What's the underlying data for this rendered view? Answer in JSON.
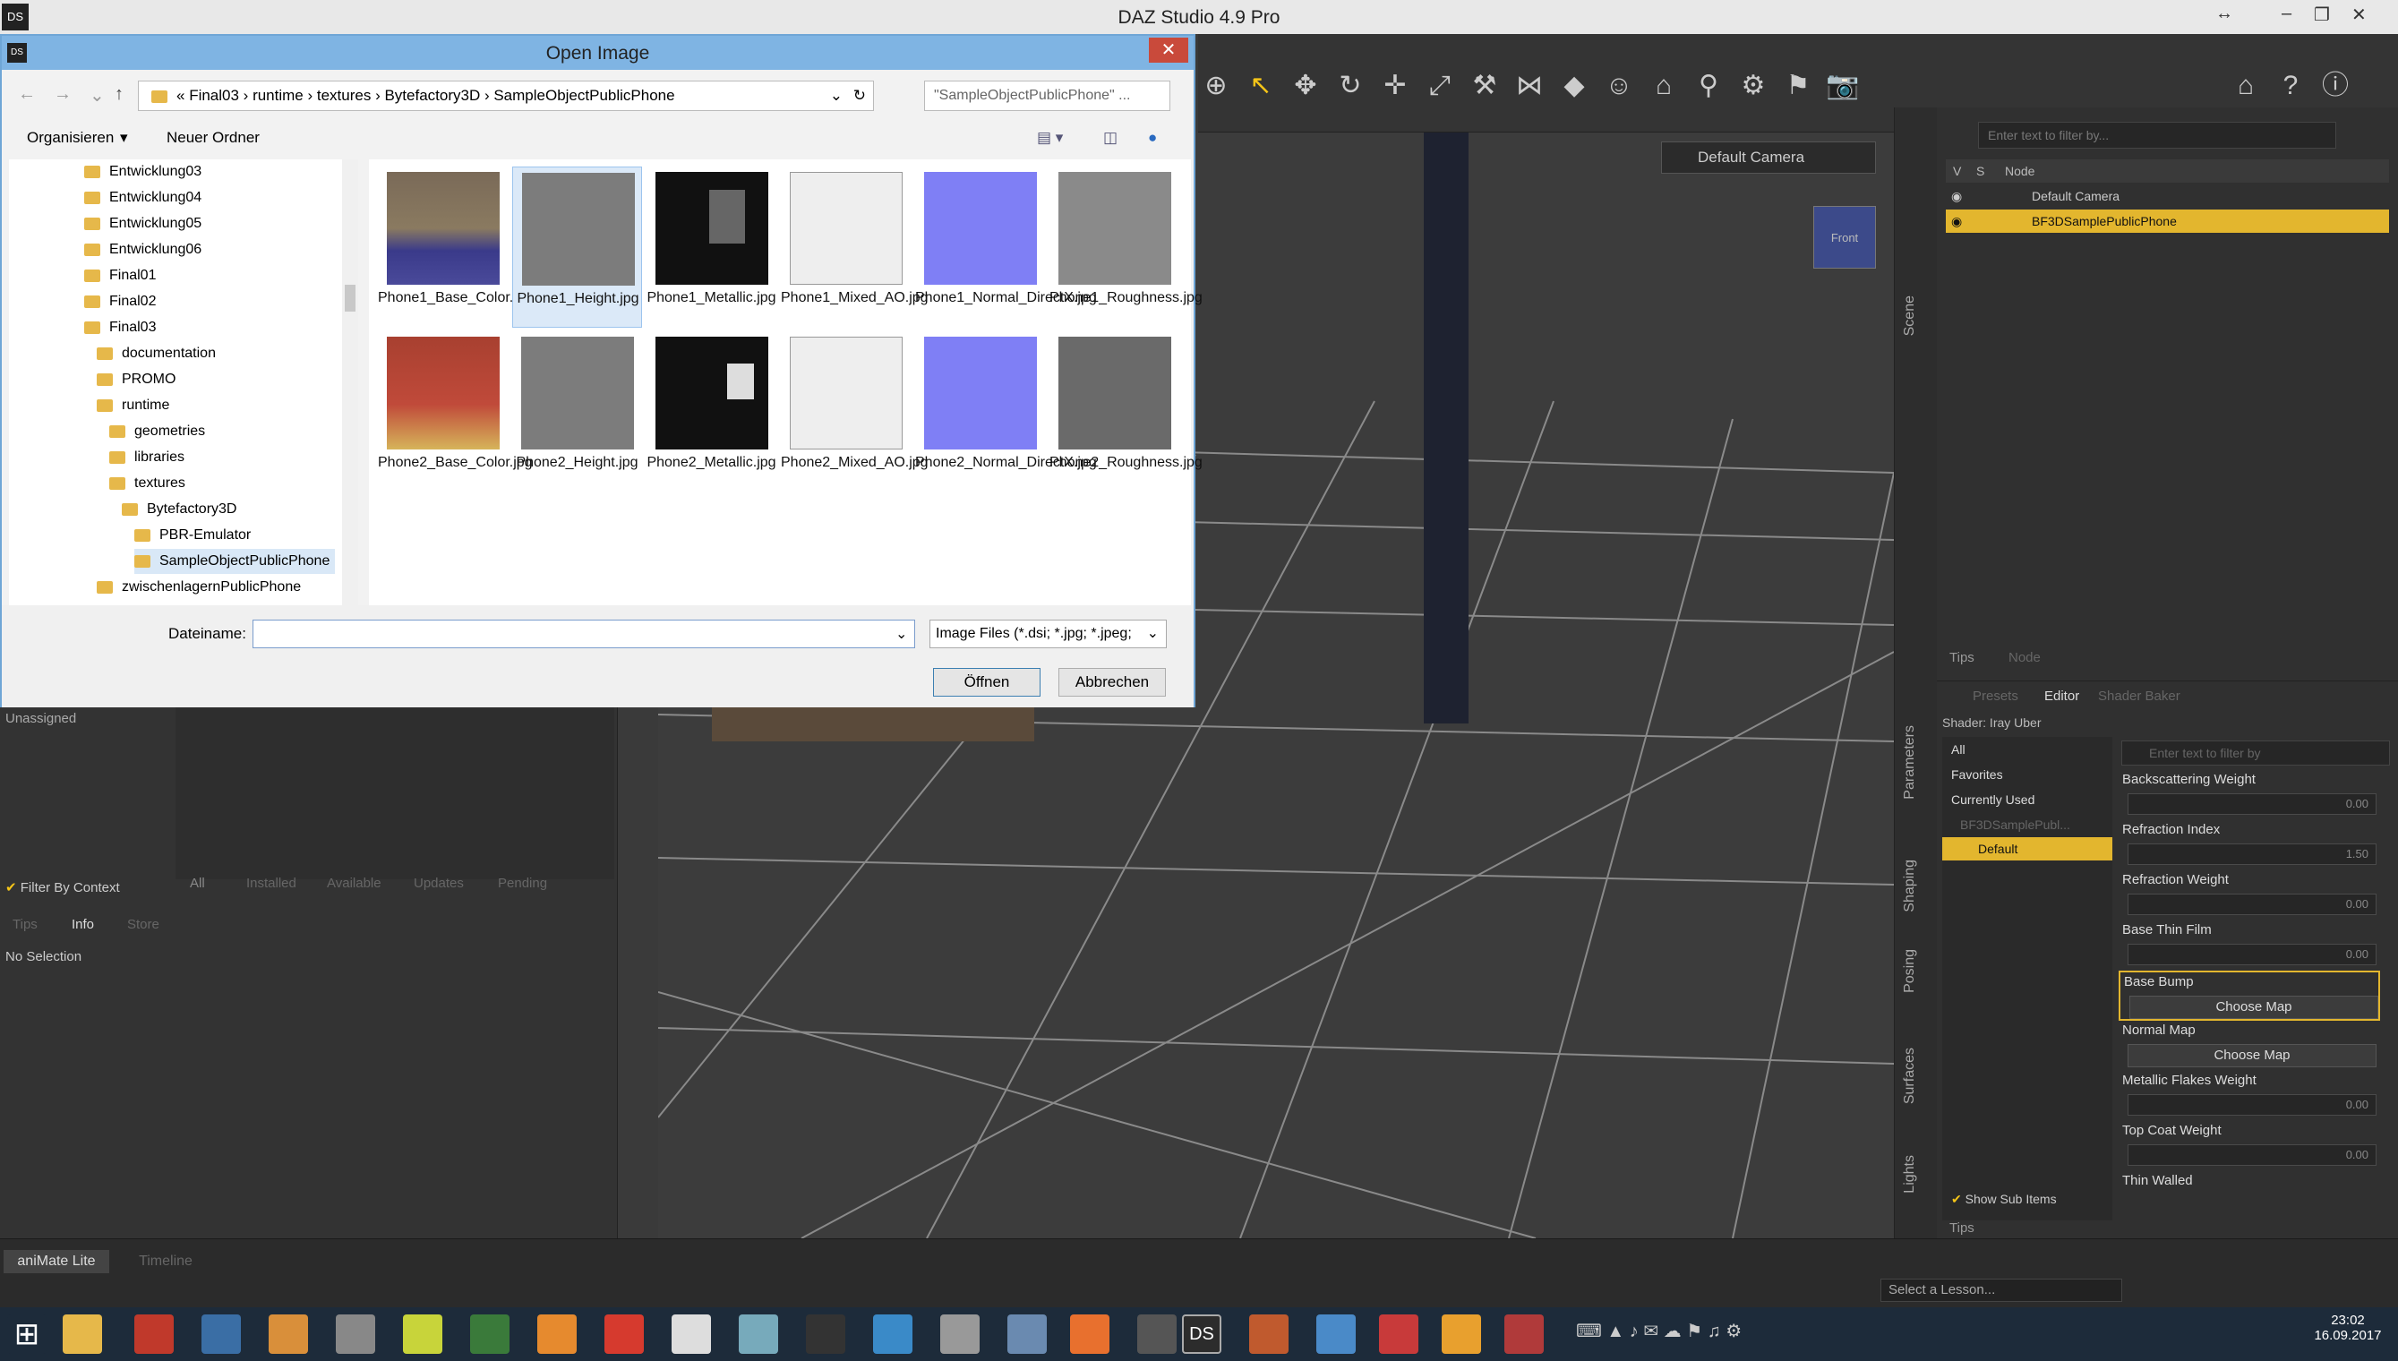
{
  "app": {
    "title": "DAZ Studio 4.9 Pro",
    "logo": "DS"
  },
  "viewport": {
    "camera": "Default Camera",
    "cube_face": "Front"
  },
  "scene": {
    "filter_placeholder": "Enter text to filter by...",
    "col_v": "V",
    "col_s": "S",
    "col_node": "Node",
    "nodes": [
      "Default Camera",
      "BF3DSamplePublicPhone"
    ],
    "tabs": [
      "Tips",
      "Node"
    ]
  },
  "right_tabs": [
    "Scene",
    "Parameters",
    "Shaping",
    "Posing",
    "Surfaces",
    "Lights"
  ],
  "surfaces": {
    "tabs": [
      "Presets",
      "Editor",
      "Shader Baker"
    ],
    "shader": "Shader: Iray Uber",
    "categories": [
      "All",
      "Favorites",
      "Currently Used"
    ],
    "object": "BF3DSamplePubl...",
    "material": "Default",
    "filter_placeholder": "Enter text to filter by",
    "show_sub": "Show Sub Items",
    "props": [
      {
        "label": "Backscattering Weight",
        "value": "0.00"
      },
      {
        "label": "Refraction Index",
        "value": "1.50"
      },
      {
        "label": "Refraction Weight",
        "value": "0.00"
      },
      {
        "label": "Base Thin Film",
        "value": "0.00"
      },
      {
        "label": "Base Bump",
        "button": "Choose Map"
      },
      {
        "label": "Normal Map",
        "button": "Choose Map"
      },
      {
        "label": "Metallic Flakes Weight",
        "value": "0.00"
      },
      {
        "label": "Top Coat Weight",
        "value": "0.00"
      },
      {
        "label": "Thin Walled"
      }
    ],
    "bottom_tab": "Tips"
  },
  "smart_content": {
    "unassigned": "Unassigned",
    "filter_context": "Filter By Context",
    "tabs": [
      "All",
      "Installed",
      "Available",
      "Updates",
      "Pending"
    ],
    "info_tabs": [
      "Tips",
      "Info",
      "Store"
    ],
    "no_selection": "No Selection"
  },
  "bottom": {
    "tabs": [
      "aniMate Lite",
      "Timeline"
    ],
    "lesson": "Select a Lesson..."
  },
  "taskbar": {
    "time": "23:02",
    "date": "16.09.2017"
  },
  "dialog": {
    "title": "Open Image",
    "breadcrumb": [
      "Final03",
      "runtime",
      "textures",
      "Bytefactory3D",
      "SampleObjectPublicPhone"
    ],
    "search_placeholder": "\"SampleObjectPublicPhone\" ...",
    "organize": "Organisieren",
    "new_folder": "Neuer Ordner",
    "tree": [
      "Entwicklung03",
      "Entwicklung04",
      "Entwicklung05",
      "Entwicklung06",
      "Final01",
      "Final02",
      "Final03",
      "documentation",
      "PROMO",
      "runtime",
      "geometries",
      "libraries",
      "textures",
      "Bytefactory3D",
      "PBR-Emulator",
      "SampleObjectPublicPhone",
      "zwischenlagernPublicPhone"
    ],
    "files": [
      {
        "name": "Phone1_Base_Color.jpg",
        "kind": "color"
      },
      {
        "name": "Phone1_Height.jpg",
        "kind": "height"
      },
      {
        "name": "Phone1_Metallic.jpg",
        "kind": "metal"
      },
      {
        "name": "Phone1_Mixed_AO.jpg",
        "kind": "ao"
      },
      {
        "name": "Phone1_Normal_DirectX.jpg",
        "kind": "normal"
      },
      {
        "name": "Phone1_Roughness.jpg",
        "kind": "rough"
      },
      {
        "name": "Phone2_Base_Color.jpg",
        "kind": "color2"
      },
      {
        "name": "Phone2_Height.jpg",
        "kind": "height"
      },
      {
        "name": "Phone2_Metallic.jpg",
        "kind": "metal"
      },
      {
        "name": "Phone2_Mixed_AO.jpg",
        "kind": "ao"
      },
      {
        "name": "Phone2_Normal_DirectX.jpg",
        "kind": "normal"
      },
      {
        "name": "Phone2_Roughness.jpg",
        "kind": "rough"
      }
    ],
    "filename_label": "Dateiname:",
    "filename_value": "",
    "filter": "Image Files (*.dsi; *.jpg; *.jpeg;",
    "open": "Öffnen",
    "cancel": "Abbrechen"
  }
}
